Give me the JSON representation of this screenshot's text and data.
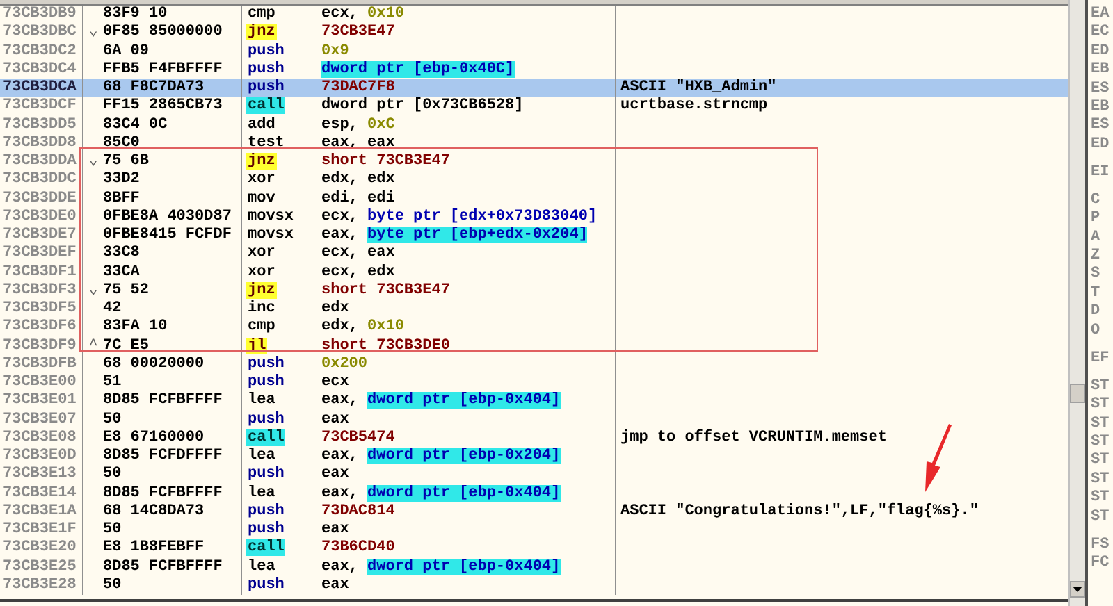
{
  "rows": [
    {
      "address": "73CB3DB9",
      "jump_mark": "",
      "bytes": "83F9 10",
      "mnemonic": "cmp",
      "kind": "plain",
      "operands": [
        {
          "text": "ecx, ",
          "kind": "plain"
        },
        {
          "text": "0x10",
          "kind": "imm"
        }
      ],
      "comment": "",
      "selected": false,
      "boxed": false
    },
    {
      "address": "73CB3DBC",
      "jump_mark": "⌄",
      "bytes": "0F85 85000000",
      "mnemonic": "jnz",
      "kind": "jump",
      "operands": [
        {
          "text": "73CB3E47",
          "kind": "addr"
        }
      ],
      "comment": "",
      "selected": false,
      "boxed": false
    },
    {
      "address": "73CB3DC2",
      "jump_mark": "",
      "bytes": "6A 09",
      "mnemonic": "push",
      "kind": "push",
      "operands": [
        {
          "text": "0x9",
          "kind": "imm"
        }
      ],
      "comment": "",
      "selected": false,
      "boxed": false
    },
    {
      "address": "73CB3DC4",
      "jump_mark": "",
      "bytes": "FFB5 F4FBFFFF",
      "mnemonic": "push",
      "kind": "push",
      "operands": [
        {
          "text": "dword ptr [ebp-0x40C]",
          "kind": "mem_hl"
        }
      ],
      "comment": "",
      "selected": false,
      "boxed": false
    },
    {
      "address": "73CB3DCA",
      "jump_mark": "",
      "bytes": "68 F8C7DA73",
      "mnemonic": "push",
      "kind": "push",
      "operands": [
        {
          "text": "73DAC7F8",
          "kind": "addr"
        }
      ],
      "comment": "ASCII \"HXB_Admin\"",
      "selected": true,
      "boxed": false
    },
    {
      "address": "73CB3DCF",
      "jump_mark": "",
      "bytes": "FF15 2865CB73",
      "mnemonic": "call",
      "kind": "call",
      "operands": [
        {
          "text": "dword ptr [0x73CB6528]",
          "kind": "plain"
        }
      ],
      "comment": "ucrtbase.strncmp",
      "selected": false,
      "boxed": false
    },
    {
      "address": "73CB3DD5",
      "jump_mark": "",
      "bytes": "83C4 0C",
      "mnemonic": "add",
      "kind": "plain",
      "operands": [
        {
          "text": "esp, ",
          "kind": "plain"
        },
        {
          "text": "0xC",
          "kind": "imm"
        }
      ],
      "comment": "",
      "selected": false,
      "boxed": false
    },
    {
      "address": "73CB3DD8",
      "jump_mark": "",
      "bytes": "85C0",
      "mnemonic": "test",
      "kind": "plain",
      "operands": [
        {
          "text": "eax, eax",
          "kind": "plain"
        }
      ],
      "comment": "",
      "selected": false,
      "boxed": false
    },
    {
      "address": "73CB3DDA",
      "jump_mark": "⌄",
      "bytes": "75 6B",
      "mnemonic": "jnz",
      "kind": "jump",
      "operands": [
        {
          "text": "short 73CB3E47",
          "kind": "addr"
        }
      ],
      "comment": "",
      "selected": false,
      "boxed": true
    },
    {
      "address": "73CB3DDC",
      "jump_mark": "",
      "bytes": "33D2",
      "mnemonic": "xor",
      "kind": "plain",
      "operands": [
        {
          "text": "edx, edx",
          "kind": "plain"
        }
      ],
      "comment": "",
      "selected": false,
      "boxed": true
    },
    {
      "address": "73CB3DDE",
      "jump_mark": "",
      "bytes": "8BFF",
      "mnemonic": "mov",
      "kind": "plain",
      "operands": [
        {
          "text": "edi, edi",
          "kind": "plain"
        }
      ],
      "comment": "",
      "selected": false,
      "boxed": true
    },
    {
      "address": "73CB3DE0",
      "jump_mark": "",
      "bytes": "0FBE8A 4030D87",
      "mnemonic": "movsx",
      "kind": "plain",
      "operands": [
        {
          "text": "ecx, ",
          "kind": "plain"
        },
        {
          "text": "byte ptr [edx+0x73D83040]",
          "kind": "mem"
        }
      ],
      "comment": "",
      "selected": false,
      "boxed": true
    },
    {
      "address": "73CB3DE7",
      "jump_mark": "",
      "bytes": "0FBE8415 FCFDF",
      "mnemonic": "movsx",
      "kind": "plain",
      "operands": [
        {
          "text": "eax, ",
          "kind": "plain"
        },
        {
          "text": "byte ptr [ebp+edx-0x204]",
          "kind": "mem_hl"
        }
      ],
      "comment": "",
      "selected": false,
      "boxed": true
    },
    {
      "address": "73CB3DEF",
      "jump_mark": "",
      "bytes": "33C8",
      "mnemonic": "xor",
      "kind": "plain",
      "operands": [
        {
          "text": "ecx, eax",
          "kind": "plain"
        }
      ],
      "comment": "",
      "selected": false,
      "boxed": true
    },
    {
      "address": "73CB3DF1",
      "jump_mark": "",
      "bytes": "33CA",
      "mnemonic": "xor",
      "kind": "plain",
      "operands": [
        {
          "text": "ecx, edx",
          "kind": "plain"
        }
      ],
      "comment": "",
      "selected": false,
      "boxed": true
    },
    {
      "address": "73CB3DF3",
      "jump_mark": "⌄",
      "bytes": "75 52",
      "mnemonic": "jnz",
      "kind": "jump",
      "operands": [
        {
          "text": "short 73CB3E47",
          "kind": "addr"
        }
      ],
      "comment": "",
      "selected": false,
      "boxed": true
    },
    {
      "address": "73CB3DF5",
      "jump_mark": "",
      "bytes": "42",
      "mnemonic": "inc",
      "kind": "plain",
      "operands": [
        {
          "text": "edx",
          "kind": "plain"
        }
      ],
      "comment": "",
      "selected": false,
      "boxed": true
    },
    {
      "address": "73CB3DF6",
      "jump_mark": "",
      "bytes": "83FA 10",
      "mnemonic": "cmp",
      "kind": "plain",
      "operands": [
        {
          "text": "edx, ",
          "kind": "plain"
        },
        {
          "text": "0x10",
          "kind": "imm"
        }
      ],
      "comment": "",
      "selected": false,
      "boxed": true
    },
    {
      "address": "73CB3DF9",
      "jump_mark": "^",
      "bytes": "7C E5",
      "mnemonic": "jl",
      "kind": "jump",
      "operands": [
        {
          "text": "short 73CB3DE0",
          "kind": "addr"
        }
      ],
      "comment": "",
      "selected": false,
      "boxed": true
    },
    {
      "address": "73CB3DFB",
      "jump_mark": "",
      "bytes": "68 00020000",
      "mnemonic": "push",
      "kind": "push",
      "operands": [
        {
          "text": "0x200",
          "kind": "imm"
        }
      ],
      "comment": "",
      "selected": false,
      "boxed": false
    },
    {
      "address": "73CB3E00",
      "jump_mark": "",
      "bytes": "51",
      "mnemonic": "push",
      "kind": "push",
      "operands": [
        {
          "text": "ecx",
          "kind": "plain"
        }
      ],
      "comment": "",
      "selected": false,
      "boxed": false
    },
    {
      "address": "73CB3E01",
      "jump_mark": "",
      "bytes": "8D85 FCFBFFFF",
      "mnemonic": "lea",
      "kind": "plain",
      "operands": [
        {
          "text": "eax, ",
          "kind": "plain"
        },
        {
          "text": "dword ptr [ebp-0x404]",
          "kind": "mem_hl"
        }
      ],
      "comment": "",
      "selected": false,
      "boxed": false
    },
    {
      "address": "73CB3E07",
      "jump_mark": "",
      "bytes": "50",
      "mnemonic": "push",
      "kind": "push",
      "operands": [
        {
          "text": "eax",
          "kind": "plain"
        }
      ],
      "comment": "",
      "selected": false,
      "boxed": false
    },
    {
      "address": "73CB3E08",
      "jump_mark": "",
      "bytes": "E8 67160000",
      "mnemonic": "call",
      "kind": "call",
      "operands": [
        {
          "text": "73CB5474",
          "kind": "addr"
        }
      ],
      "comment": "jmp to offset VCRUNTIM.memset",
      "selected": false,
      "boxed": false
    },
    {
      "address": "73CB3E0D",
      "jump_mark": "",
      "bytes": "8D85 FCFDFFFF",
      "mnemonic": "lea",
      "kind": "plain",
      "operands": [
        {
          "text": "eax, ",
          "kind": "plain"
        },
        {
          "text": "dword ptr [ebp-0x204]",
          "kind": "mem_hl"
        }
      ],
      "comment": "",
      "selected": false,
      "boxed": false
    },
    {
      "address": "73CB3E13",
      "jump_mark": "",
      "bytes": "50",
      "mnemonic": "push",
      "kind": "push",
      "operands": [
        {
          "text": "eax",
          "kind": "plain"
        }
      ],
      "comment": "",
      "selected": false,
      "boxed": false
    },
    {
      "address": "73CB3E14",
      "jump_mark": "",
      "bytes": "8D85 FCFBFFFF",
      "mnemonic": "lea",
      "kind": "plain",
      "operands": [
        {
          "text": "eax, ",
          "kind": "plain"
        },
        {
          "text": "dword ptr [ebp-0x404]",
          "kind": "mem_hl"
        }
      ],
      "comment": "",
      "selected": false,
      "boxed": false
    },
    {
      "address": "73CB3E1A",
      "jump_mark": "",
      "bytes": "68 14C8DA73",
      "mnemonic": "push",
      "kind": "push",
      "operands": [
        {
          "text": "73DAC814",
          "kind": "addr"
        }
      ],
      "comment": "ASCII \"Congratulations!\",LF,\"flag{%s}.\"",
      "selected": false,
      "boxed": false
    },
    {
      "address": "73CB3E1F",
      "jump_mark": "",
      "bytes": "50",
      "mnemonic": "push",
      "kind": "push",
      "operands": [
        {
          "text": "eax",
          "kind": "plain"
        }
      ],
      "comment": "",
      "selected": false,
      "boxed": false
    },
    {
      "address": "73CB3E20",
      "jump_mark": "",
      "bytes": "E8 1B8FEBFF",
      "mnemonic": "call",
      "kind": "call",
      "operands": [
        {
          "text": "73B6CD40",
          "kind": "addr"
        }
      ],
      "comment": "",
      "selected": false,
      "boxed": false
    },
    {
      "address": "73CB3E25",
      "jump_mark": "",
      "bytes": "8D85 FCFBFFFF",
      "mnemonic": "lea",
      "kind": "plain",
      "operands": [
        {
          "text": "eax, ",
          "kind": "plain"
        },
        {
          "text": "dword ptr [ebp-0x404]",
          "kind": "mem_hl"
        }
      ],
      "comment": "",
      "selected": false,
      "boxed": false
    },
    {
      "address": "73CB3E28",
      "jump_mark": "",
      "bytes": "50",
      "mnemonic": "push",
      "kind": "push",
      "operands": [
        {
          "text": "eax",
          "kind": "plain"
        }
      ],
      "comment": "",
      "selected": false,
      "boxed": false
    }
  ],
  "register_pane": {
    "groups": [
      [
        "EA",
        "EC",
        "ED",
        "EB",
        "ES",
        "EB",
        "ES",
        "ED"
      ],
      [
        "EI"
      ],
      [
        "C",
        "P",
        "A",
        "Z",
        "S",
        "T",
        "D",
        "O"
      ],
      [
        "EF"
      ],
      [
        "ST",
        "ST",
        "ST",
        "ST",
        "ST",
        "ST",
        "ST",
        "ST"
      ],
      [
        "FS",
        "FC"
      ]
    ]
  }
}
